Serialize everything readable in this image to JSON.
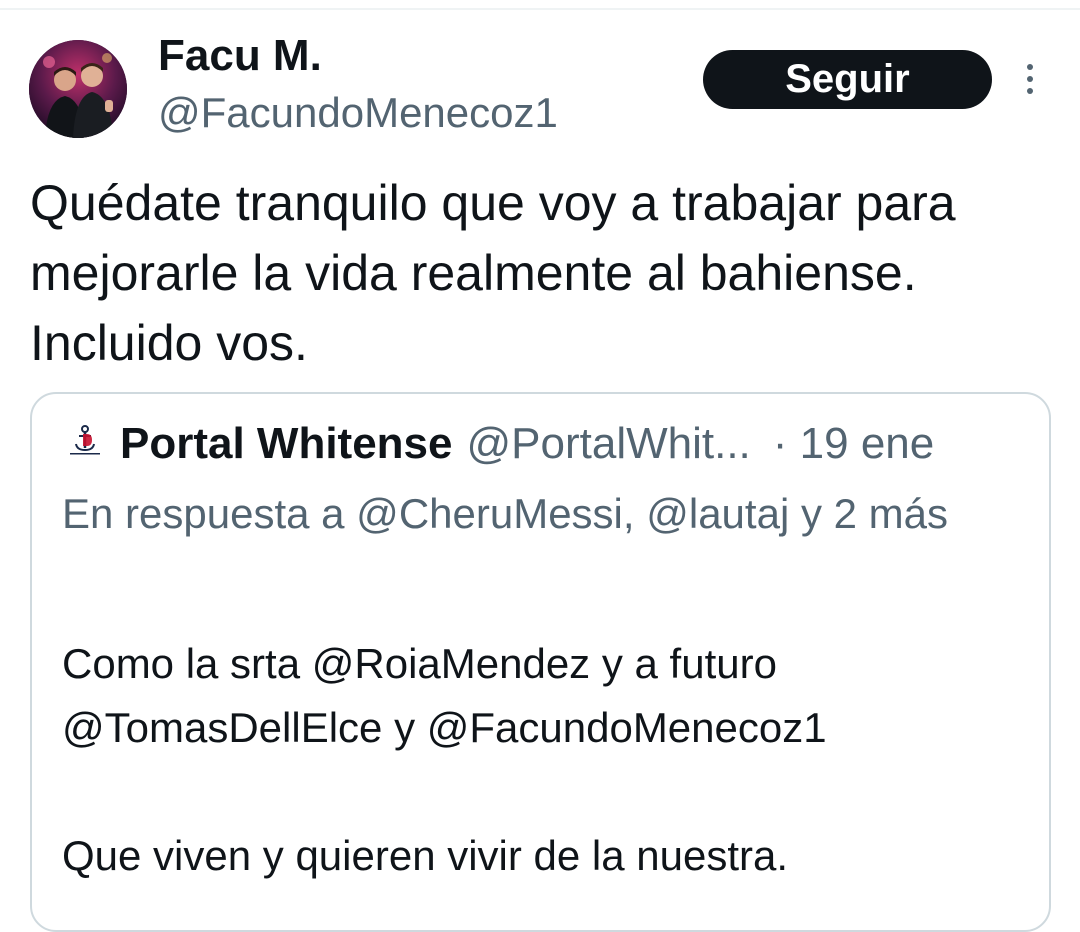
{
  "tweet": {
    "author": {
      "name": "Facu M.",
      "handle": "@FacundoMenecoz1",
      "avatar_icon": "profile-photo"
    },
    "follow_label": "Seguir",
    "more_icon": "vertical-ellipsis-icon",
    "text": "Quédate tranquilo que voy a trabajar para mejorarle la vida realmente al bahiense. Incluido vos."
  },
  "quoted": {
    "logo_text": "PORTAL WHITENSE",
    "author_name": "Portal Whitense",
    "handle": "@PortalWhit...",
    "date": "· 19 ene",
    "reply_context": "En respuesta a @CheruMessi, @lautaj y 2 más",
    "body": {
      "line1": "Como la srta @RoiaMendez y a futuro",
      "line2": "@TomasDellElce y @FacundoMenecoz1",
      "line3": "",
      "line4": "Que viven y quieren vivir de la nuestra."
    }
  },
  "colors": {
    "text_primary": "#0f1419",
    "text_secondary": "#536471",
    "follow_bg": "#0f1419",
    "card_border": "#cfd9de",
    "logo_red": "#c8102e",
    "logo_navy": "#1b2a4a"
  }
}
